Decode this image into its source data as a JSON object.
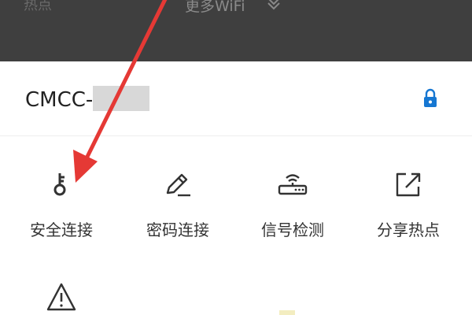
{
  "top_bar": {
    "left_label": "热点",
    "more_wifi_label": "更多WiFi",
    "background_color": "#3f3f3f"
  },
  "network": {
    "ssid_visible": "CMCC-",
    "lock_icon": "lock-icon",
    "accent_color": "#1677d2"
  },
  "actions": [
    {
      "icon": "key-icon",
      "label": "安全连接"
    },
    {
      "icon": "pencil-icon",
      "label": "密码连接"
    },
    {
      "icon": "router-signal-icon",
      "label": "信号检测"
    },
    {
      "icon": "share-icon",
      "label": "分享热点"
    }
  ],
  "extra": {
    "warning_icon": "warning-icon",
    "annotation_color": "#e53935"
  }
}
